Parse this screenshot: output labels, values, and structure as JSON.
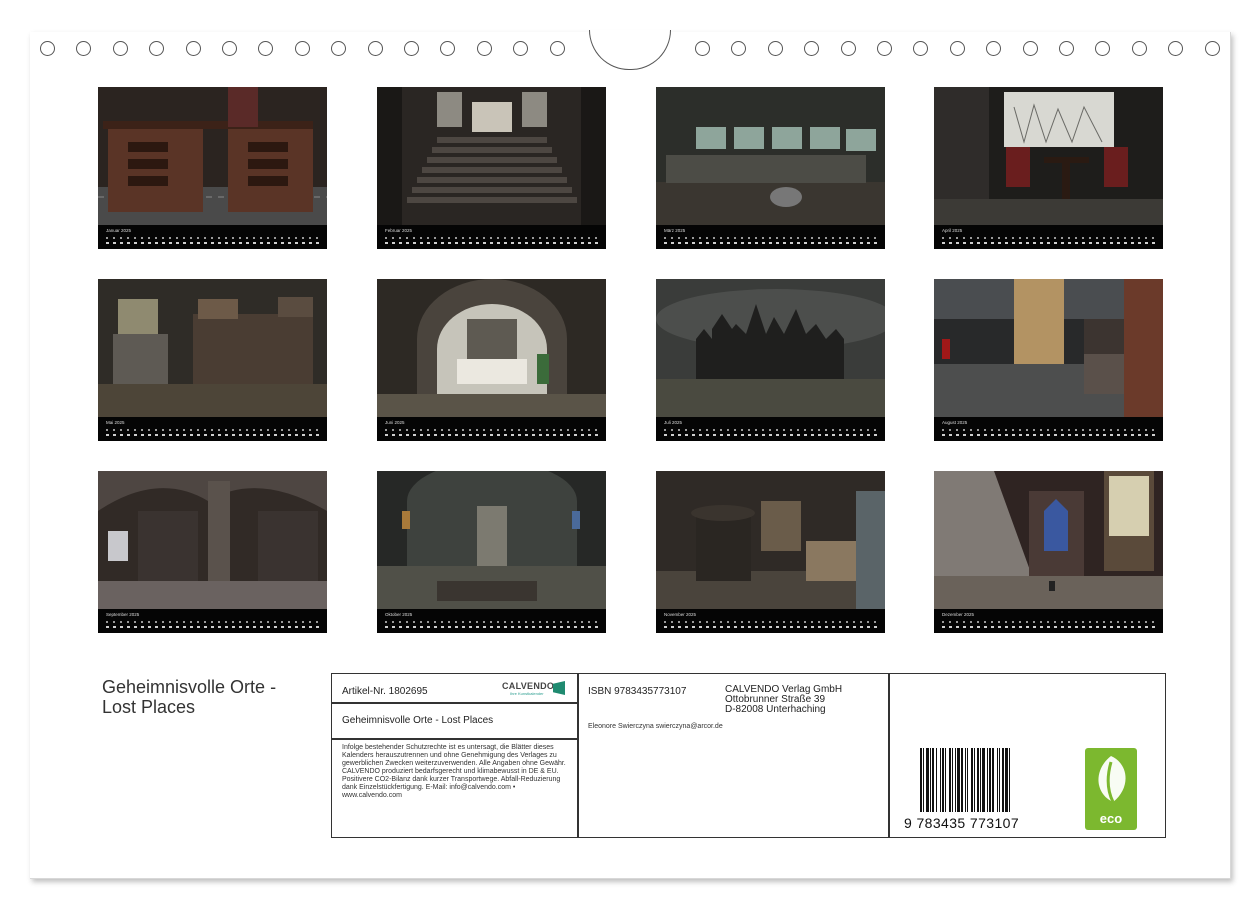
{
  "calendar": {
    "months": [
      {
        "label": "Januar 2025",
        "scene": "desks"
      },
      {
        "label": "Februar 2025",
        "scene": "staircase"
      },
      {
        "label": "März 2025",
        "scene": "control-room"
      },
      {
        "label": "April 2025",
        "scene": "window-chairs"
      },
      {
        "label": "Mai 2025",
        "scene": "furniture"
      },
      {
        "label": "Juni 2025",
        "scene": "archway"
      },
      {
        "label": "Juli 2025",
        "scene": "castle"
      },
      {
        "label": "August 2025",
        "scene": "factory-chair"
      },
      {
        "label": "September 2025",
        "scene": "pillar-hall"
      },
      {
        "label": "Oktober 2025",
        "scene": "church-ruin"
      },
      {
        "label": "November 2025",
        "scene": "stove"
      },
      {
        "label": "Dezember 2025",
        "scene": "chapel-light"
      }
    ]
  },
  "cover": {
    "title_line1": "Geheimnisvolle Orte -",
    "title_line2": "Lost Places"
  },
  "info": {
    "article": "Artikel-Nr. 1802695",
    "logo_word": "CALVENDO",
    "logo_sub": "Ihre Kunstkalender",
    "product_title": "Geheimnisvolle Orte - Lost Places",
    "legal_text": "Infolge bestehender Schutzrechte ist es untersagt, die Blätter dieses Kalenders herauszutrennen und ohne Genehmigung des Verlages zu gewerblichen Zwecken weiterzuverwenden. Alle Angaben ohne Gewähr. CALVENDO produziert bedarfsgerecht und klimabewusst in DE & EU. Positivere CO2-Bilanz dank kurzer Transportwege. Abfall-Reduzierung dank Einzelstückfertigung. E-Mail: info@calvendo.com • www.calvendo.com",
    "isbn": "ISBN 9783435773107",
    "publisher_line1": "CALVENDO Verlag GmbH",
    "publisher_line2": "Ottobrunner Straße 39",
    "publisher_line3": "D-82008 Unterhaching",
    "author": "Eleonore Swierczyna swierczyna@arcor.de",
    "barcode_digits": "9 783435 773107",
    "eco_label": "eco"
  },
  "colors": {
    "eco_green": "#7cb82f",
    "logo_teal": "#1f8a70"
  }
}
